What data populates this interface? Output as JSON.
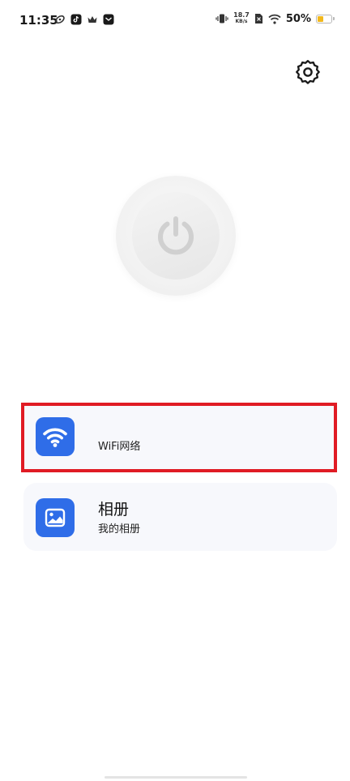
{
  "status_bar": {
    "time": "11:35",
    "net_speed_value": "18.7",
    "net_speed_unit": "KB/s",
    "battery_percent_text": "50%",
    "battery_level": 0.5,
    "battery_color": "#f2b81c"
  },
  "settings": {
    "icon": "gear-icon"
  },
  "power_button": {
    "icon": "power-icon"
  },
  "list": {
    "items": [
      {
        "icon": "wifi-icon",
        "title": "",
        "subtitle": "WiFi网络",
        "highlighted": true
      },
      {
        "icon": "gallery-icon",
        "title": "相册",
        "subtitle": "我的相册",
        "highlighted": false
      }
    ]
  },
  "colors": {
    "accent": "#2f6de8",
    "highlight_border": "#e01b24",
    "card_background": "#f7f8fc"
  }
}
